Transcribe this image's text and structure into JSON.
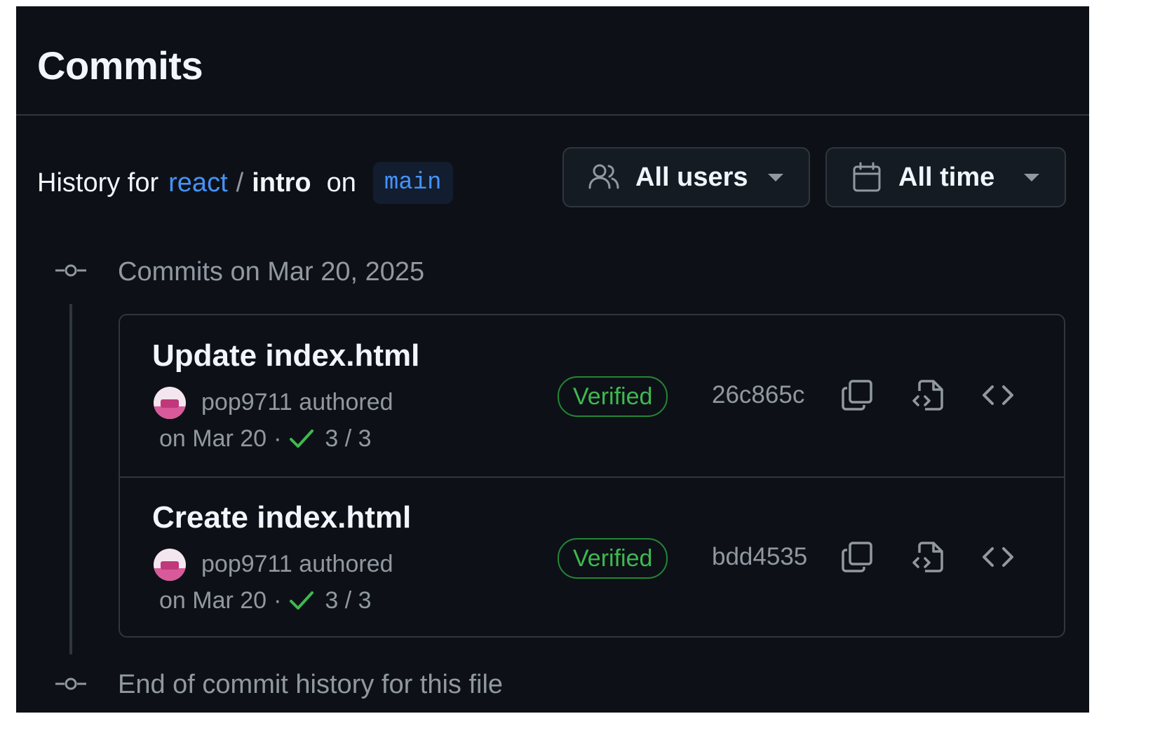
{
  "page": {
    "title": "Commits"
  },
  "history": {
    "prefix": "History for",
    "owner": "react",
    "separator": "/",
    "file": "intro",
    "on_label": "on",
    "branch": "main"
  },
  "filters": {
    "users": {
      "label": "All users",
      "icon": "people-icon"
    },
    "time": {
      "label": "All time",
      "icon": "calendar-icon"
    }
  },
  "group": {
    "title": "Commits on Mar 20, 2025"
  },
  "commits": [
    {
      "message": "Update index.html",
      "author_text": "pop9711 authored",
      "date_text": "on Mar 20",
      "dot": "·",
      "checks": "3 / 3",
      "badge": "Verified",
      "sha": "26c865c"
    },
    {
      "message": "Create index.html",
      "author_text": "pop9711 authored",
      "date_text": "on Mar 20",
      "dot": "·",
      "checks": "3 / 3",
      "badge": "Verified",
      "sha": "bdd4535"
    }
  ],
  "end_text": "End of commit history for this file",
  "colors": {
    "background": "#0d1117",
    "link": "#4493f8",
    "verified": "#3fb950",
    "muted": "#9198a1",
    "border": "#30363d"
  }
}
